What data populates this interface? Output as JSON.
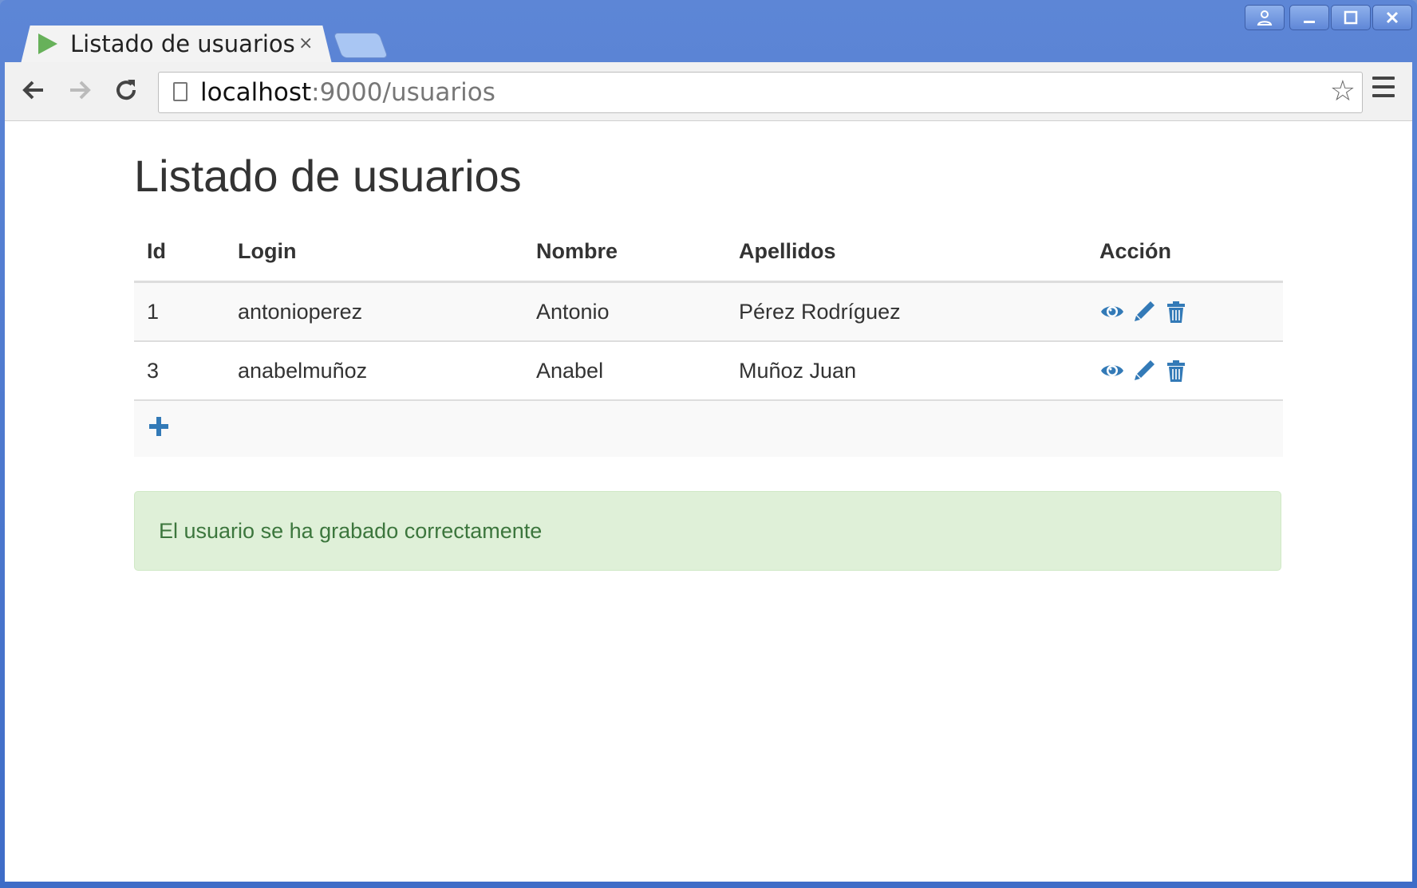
{
  "browser": {
    "tab_title": "Listado de usuarios",
    "tab_close": "×",
    "url_host": "localhost",
    "url_path": ":9000/usuarios"
  },
  "page": {
    "title": "Listado de usuarios",
    "columns": [
      "Id",
      "Login",
      "Nombre",
      "Apellidos",
      "Acción"
    ],
    "rows": [
      {
        "id": "1",
        "login": "antonioperez",
        "nombre": "Antonio",
        "apellidos": "Pérez Rodríguez"
      },
      {
        "id": "3",
        "login": "anabelmuñoz",
        "nombre": "Anabel",
        "apellidos": "Muñoz Juan"
      }
    ],
    "alert": "El usuario se ha grabado correctamente"
  },
  "colors": {
    "accent": "#337ab7",
    "success_bg": "#dff0d8",
    "success_text": "#3c763d",
    "chrome_blue": "#4a78d0"
  },
  "icons": [
    "play-favicon",
    "back-icon",
    "forward-icon",
    "reload-icon",
    "page-icon",
    "star-icon",
    "menu-icon",
    "eye-icon",
    "pencil-icon",
    "trash-icon",
    "plus-icon"
  ]
}
